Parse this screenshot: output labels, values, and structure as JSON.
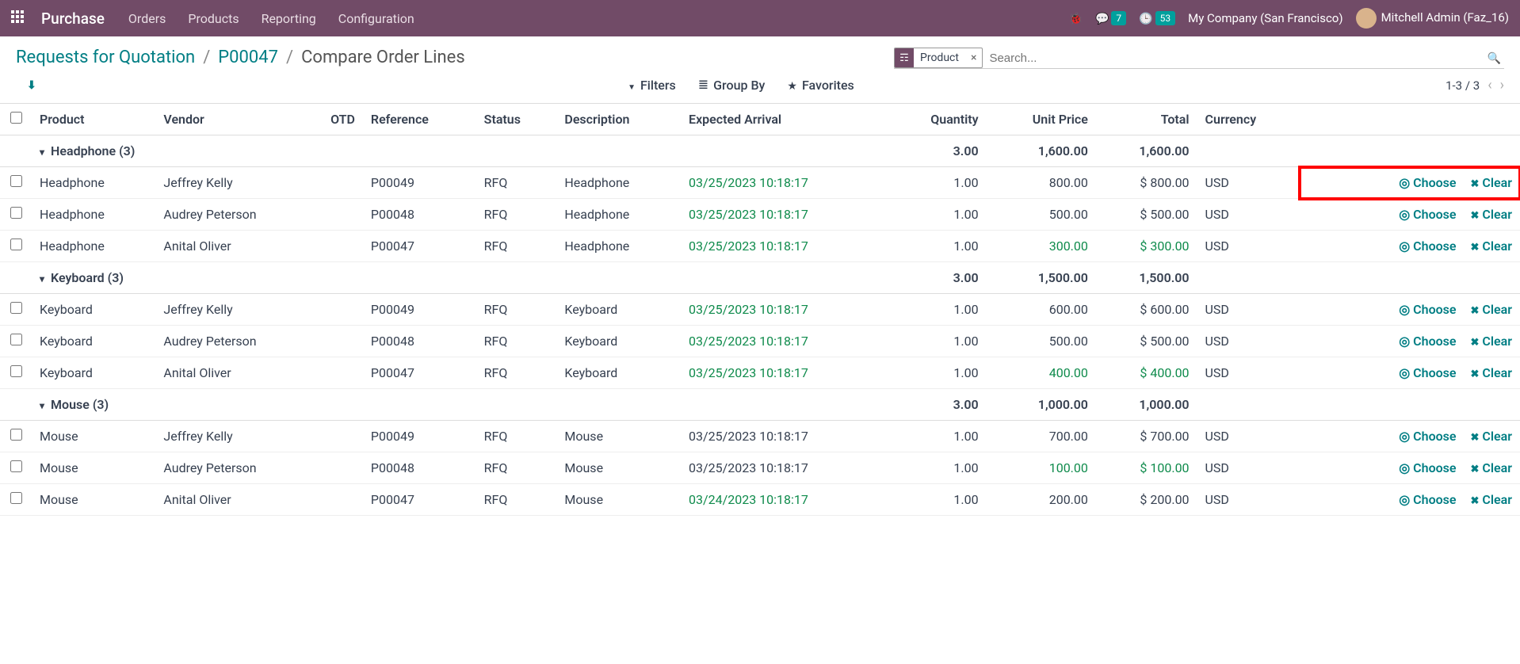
{
  "topbar": {
    "brand": "Purchase",
    "menu": [
      "Orders",
      "Products",
      "Reporting",
      "Configuration"
    ],
    "chat_count": "7",
    "timer_count": "53",
    "company": "My Company (San Francisco)",
    "user": "Mitchell Admin (Faz_16)"
  },
  "breadcrumb": {
    "root": "Requests for Quotation",
    "mid": "P00047",
    "current": "Compare Order Lines"
  },
  "search": {
    "facet_label": "Product",
    "placeholder": "Search..."
  },
  "tools": {
    "filters": "Filters",
    "groupby": "Group By",
    "favorites": "Favorites"
  },
  "pager": {
    "text": "1-3 / 3"
  },
  "columns": {
    "product": "Product",
    "vendor": "Vendor",
    "otd": "OTD",
    "reference": "Reference",
    "status": "Status",
    "description": "Description",
    "arrival": "Expected Arrival",
    "qty": "Quantity",
    "price": "Unit Price",
    "total": "Total",
    "currency": "Currency"
  },
  "action_labels": {
    "choose": "Choose",
    "clear": "Clear"
  },
  "groups": [
    {
      "name": "Headphone",
      "count": "3",
      "qty": "3.00",
      "price": "1,600.00",
      "total": "1,600.00",
      "rows": [
        {
          "product": "Headphone",
          "vendor": "Jeffrey Kelly",
          "ref": "P00049",
          "status": "RFQ",
          "desc": "Headphone",
          "arrival": "03/25/2023 10:18:17",
          "arrival_green": true,
          "qty": "1.00",
          "price": "800.00",
          "total": "$ 800.00",
          "curr": "USD",
          "best": false,
          "highlight": true
        },
        {
          "product": "Headphone",
          "vendor": "Audrey Peterson",
          "ref": "P00048",
          "status": "RFQ",
          "desc": "Headphone",
          "arrival": "03/25/2023 10:18:17",
          "arrival_green": true,
          "qty": "1.00",
          "price": "500.00",
          "total": "$ 500.00",
          "curr": "USD",
          "best": false
        },
        {
          "product": "Headphone",
          "vendor": "Anital Oliver",
          "ref": "P00047",
          "status": "RFQ",
          "desc": "Headphone",
          "arrival": "03/25/2023 10:18:17",
          "arrival_green": true,
          "qty": "1.00",
          "price": "300.00",
          "total": "$ 300.00",
          "curr": "USD",
          "best": true
        }
      ]
    },
    {
      "name": "Keyboard",
      "count": "3",
      "qty": "3.00",
      "price": "1,500.00",
      "total": "1,500.00",
      "rows": [
        {
          "product": "Keyboard",
          "vendor": "Jeffrey Kelly",
          "ref": "P00049",
          "status": "RFQ",
          "desc": "Keyboard",
          "arrival": "03/25/2023 10:18:17",
          "arrival_green": true,
          "qty": "1.00",
          "price": "600.00",
          "total": "$ 600.00",
          "curr": "USD",
          "best": false
        },
        {
          "product": "Keyboard",
          "vendor": "Audrey Peterson",
          "ref": "P00048",
          "status": "RFQ",
          "desc": "Keyboard",
          "arrival": "03/25/2023 10:18:17",
          "arrival_green": true,
          "qty": "1.00",
          "price": "500.00",
          "total": "$ 500.00",
          "curr": "USD",
          "best": false
        },
        {
          "product": "Keyboard",
          "vendor": "Anital Oliver",
          "ref": "P00047",
          "status": "RFQ",
          "desc": "Keyboard",
          "arrival": "03/25/2023 10:18:17",
          "arrival_green": true,
          "qty": "1.00",
          "price": "400.00",
          "total": "$ 400.00",
          "curr": "USD",
          "best": true
        }
      ]
    },
    {
      "name": "Mouse",
      "count": "3",
      "qty": "3.00",
      "price": "1,000.00",
      "total": "1,000.00",
      "rows": [
        {
          "product": "Mouse",
          "vendor": "Jeffrey Kelly",
          "ref": "P00049",
          "status": "RFQ",
          "desc": "Mouse",
          "arrival": "03/25/2023 10:18:17",
          "arrival_green": false,
          "qty": "1.00",
          "price": "700.00",
          "total": "$ 700.00",
          "curr": "USD",
          "best": false
        },
        {
          "product": "Mouse",
          "vendor": "Audrey Peterson",
          "ref": "P00048",
          "status": "RFQ",
          "desc": "Mouse",
          "arrival": "03/25/2023 10:18:17",
          "arrival_green": false,
          "qty": "1.00",
          "price": "100.00",
          "total": "$ 100.00",
          "curr": "USD",
          "best": true
        },
        {
          "product": "Mouse",
          "vendor": "Anital Oliver",
          "ref": "P00047",
          "status": "RFQ",
          "desc": "Mouse",
          "arrival": "03/24/2023 10:18:17",
          "arrival_green": true,
          "qty": "1.00",
          "price": "200.00",
          "total": "$ 200.00",
          "curr": "USD",
          "best": false
        }
      ]
    }
  ]
}
